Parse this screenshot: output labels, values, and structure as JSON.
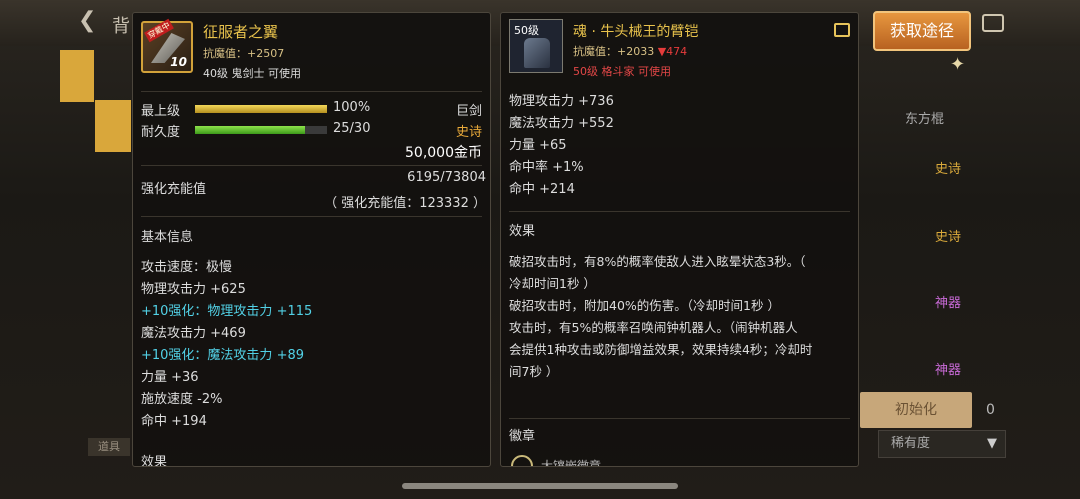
{
  "header": {
    "back_label": "背",
    "acquire_button": "获取途径"
  },
  "background": {
    "tags": [
      "东方棍",
      "史诗",
      "史诗",
      "神器",
      "神器"
    ],
    "reset_button": "初始化",
    "rarity_select": "稀有度",
    "side_number": "0",
    "left_tag": "道具"
  },
  "item1": {
    "name": "征服者之翼",
    "icon_badge": "穿戴中",
    "icon_level": "10",
    "resist": "抗魔值：+2507",
    "requirement": "40级 鬼剑士 可使用",
    "max_level_label": "最上级",
    "max_level_pct": "100%",
    "max_level_fill": 1.0,
    "durability_label": "耐久度",
    "durability_value": "25/30",
    "durability_fill": 0.833,
    "type": "巨剑",
    "rarity": "史诗",
    "price": "50,000金币",
    "enhance_label": "强化充能值",
    "enhance_value": "6195/73804",
    "enhance_sub": "（ 强化充能值：123332 ）",
    "basic_info": "基本信息",
    "stats": [
      {
        "text": "攻击速度：极慢",
        "color": "plain"
      },
      {
        "text": "物理攻击力 +625",
        "color": "plain"
      },
      {
        "text": "+10强化：物理攻击力 +115",
        "color": "cyan"
      },
      {
        "text": "魔法攻击力 +469",
        "color": "plain"
      },
      {
        "text": "+10强化：魔法攻击力 +89",
        "color": "cyan"
      },
      {
        "text": "力量 +36",
        "color": "plain"
      },
      {
        "text": "施放速度 -2%",
        "color": "plain"
      },
      {
        "text": "命中 +194",
        "color": "plain"
      }
    ],
    "effect_heading": "效果"
  },
  "item2": {
    "icon_level": "50级",
    "name": "魂 · 牛头械王的臂铠",
    "resist": "抗魔值：+2033 ",
    "resist_down": "▼474",
    "requirement": "50级 格斗家 可使用",
    "stats": [
      "物理攻击力 +736",
      "魔法攻击力 +552",
      "力量 +65",
      "命中率 +1%",
      "命中 +214"
    ],
    "effect_heading": "效果",
    "effect_lines": [
      "破招攻击时，有8%的概率使敌人进入眩晕状态3秒。（",
      "冷却时间1秒 ）",
      "破招攻击时，附加40%的伤害。（冷却时间1秒 ）",
      "攻击时，有5%的概率召唤闹钟机器人。（闹钟机器人",
      "会提供1种攻击或防御增益效果，效果持续4秒；冷却时",
      "间7秒 ）"
    ],
    "emblem_heading": "徽章",
    "emblem_name": "大镶嵌徽章"
  }
}
